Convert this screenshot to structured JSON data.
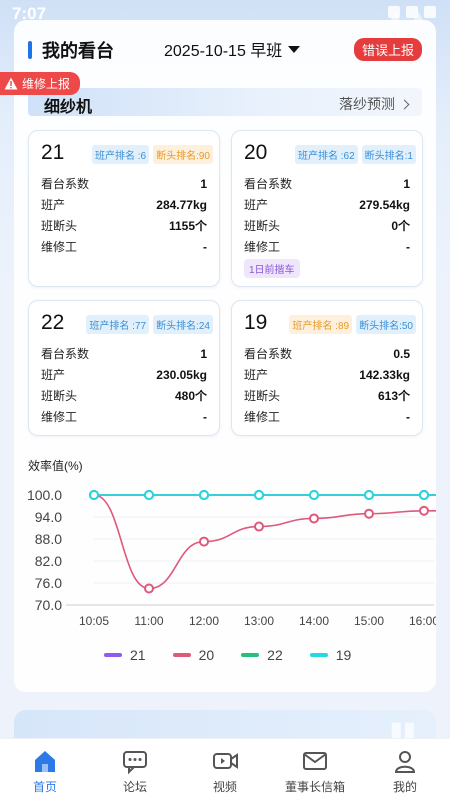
{
  "status": {
    "time": "7:07"
  },
  "header": {
    "title": "我的看台",
    "date_shift": "2025-10-15 早班",
    "error_report": "错误上报",
    "repair_report": "维修上报"
  },
  "section": {
    "title": "细纱机",
    "link": "落纱预测"
  },
  "machines": [
    {
      "number": "21",
      "badges": [
        {
          "text": "班产排名 :6",
          "tone": "blue"
        },
        {
          "text": "断头排名:90",
          "tone": "orange"
        }
      ],
      "rows": [
        {
          "label": "看台系数",
          "value": "1"
        },
        {
          "label": "班产",
          "value": "284.77kg"
        },
        {
          "label": "班断头",
          "value": "1155个"
        },
        {
          "label": "维修工",
          "value": "-"
        }
      ],
      "tag": ""
    },
    {
      "number": "20",
      "badges": [
        {
          "text": "班产排名 :62",
          "tone": "blue"
        },
        {
          "text": "断头排名:1",
          "tone": "blue"
        }
      ],
      "rows": [
        {
          "label": "看台系数",
          "value": "1"
        },
        {
          "label": "班产",
          "value": "279.54kg"
        },
        {
          "label": "班断头",
          "value": "0个"
        },
        {
          "label": "维修工",
          "value": "-"
        }
      ],
      "tag": "1日前揩车"
    },
    {
      "number": "22",
      "badges": [
        {
          "text": "班产排名 :77",
          "tone": "blue"
        },
        {
          "text": "断头排名:24",
          "tone": "blue"
        }
      ],
      "rows": [
        {
          "label": "看台系数",
          "value": "1"
        },
        {
          "label": "班产",
          "value": "230.05kg"
        },
        {
          "label": "班断头",
          "value": "480个"
        },
        {
          "label": "维修工",
          "value": "-"
        }
      ],
      "tag": ""
    },
    {
      "number": "19",
      "badges": [
        {
          "text": "班产排名 :89",
          "tone": "orange"
        },
        {
          "text": "断头排名:50",
          "tone": "blue"
        }
      ],
      "rows": [
        {
          "label": "看台系数",
          "value": "0.5"
        },
        {
          "label": "班产",
          "value": "142.33kg"
        },
        {
          "label": "班断头",
          "value": "613个"
        },
        {
          "label": "维修工",
          "value": "-"
        }
      ],
      "tag": ""
    }
  ],
  "chart_data": {
    "type": "line",
    "title": "效率值(%)",
    "xlabel": "",
    "ylabel": "效率值(%)",
    "categories": [
      "10:05",
      "11:00",
      "12:00",
      "13:00",
      "14:00",
      "15:00",
      "16:00"
    ],
    "y_ticks": [
      "100.0",
      "94.0",
      "88.0",
      "82.0",
      "76.0",
      "70.0"
    ],
    "ylim": [
      70,
      100
    ],
    "series": [
      {
        "name": "21",
        "color": "#8a5cf0",
        "values": [
          100,
          100,
          100,
          100,
          100,
          100,
          100
        ]
      },
      {
        "name": "20",
        "color": "#e0587a",
        "values": [
          100,
          74.5,
          87.3,
          91.4,
          93.6,
          94.9,
          95.7
        ]
      },
      {
        "name": "22",
        "color": "#22c07a",
        "values": [
          100,
          100,
          100,
          100,
          100,
          100,
          100
        ]
      },
      {
        "name": "19",
        "color": "#25d8e2",
        "values": [
          100,
          100,
          100,
          100,
          100,
          100,
          100
        ]
      }
    ],
    "grid": true,
    "legend": "bottom"
  },
  "tabbar": [
    {
      "label": "首页",
      "icon": "home-icon",
      "active": true
    },
    {
      "label": "论坛",
      "icon": "forum-icon",
      "active": false
    },
    {
      "label": "视频",
      "icon": "video-icon",
      "active": false
    },
    {
      "label": "董事长信箱",
      "icon": "mail-icon",
      "active": false
    },
    {
      "label": "我的",
      "icon": "user-icon",
      "active": false
    }
  ]
}
